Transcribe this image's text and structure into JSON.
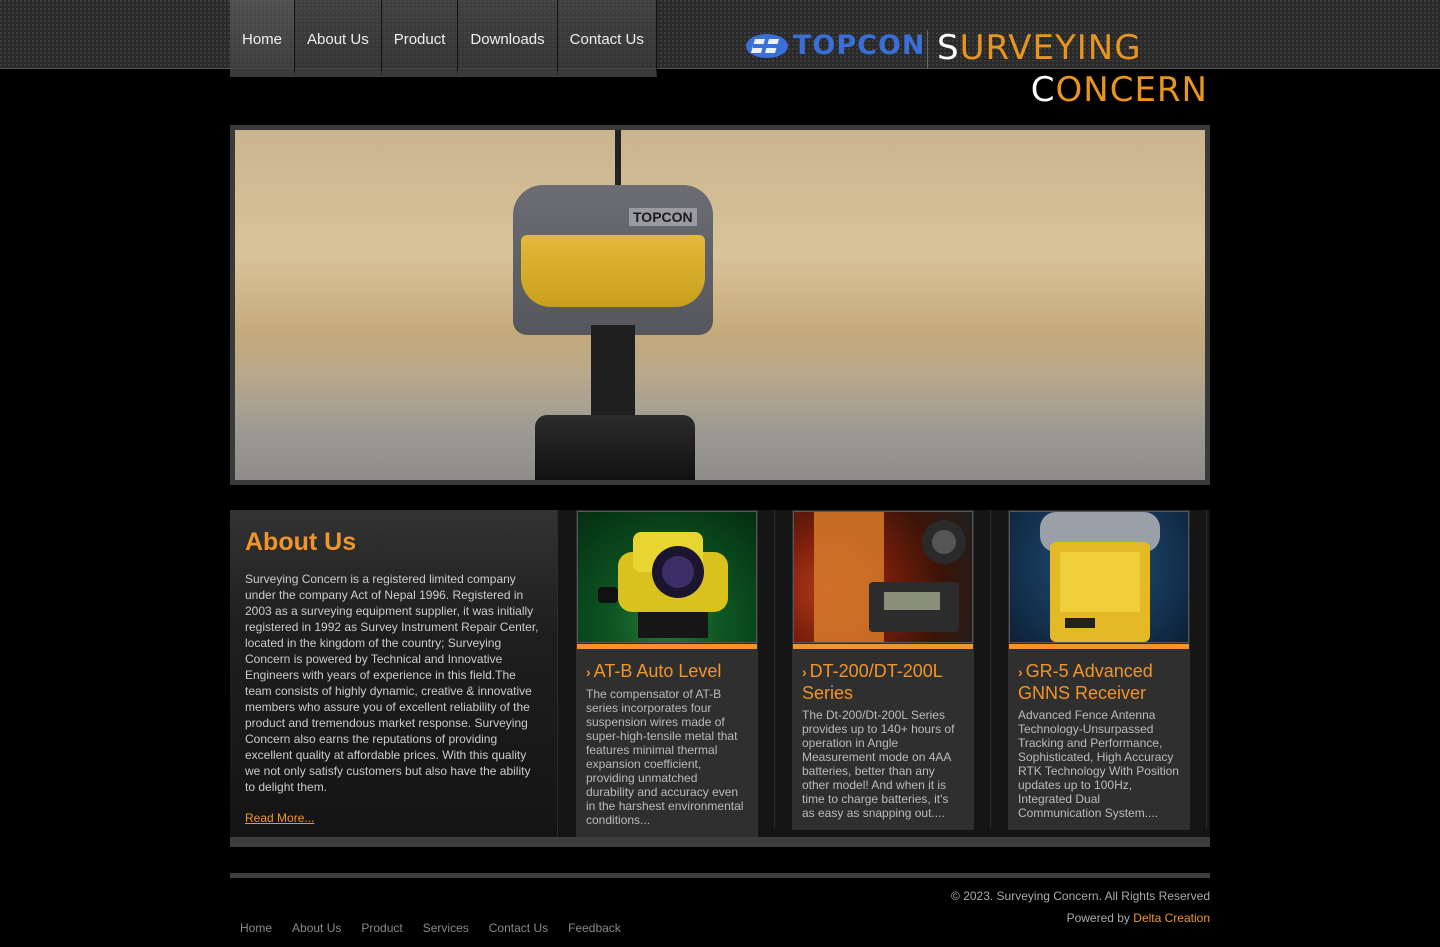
{
  "nav": {
    "items": [
      "Home",
      "About Us",
      "Product",
      "Downloads",
      "Contact Us"
    ]
  },
  "logo": {
    "brand": "TOPCON",
    "word1_cap": "S",
    "word1_rest": "URVEYING",
    "word2_cap": "C",
    "word2_rest": "ONCERN"
  },
  "banner": {
    "device_label": "TOPCON"
  },
  "about": {
    "title": "About Us",
    "body": "Surveying Concern is a registered limited company under the company Act of Nepal 1996. Registered in 2003 as a surveying equipment supplier, it was initially registered in 1992 as Survey Instrument Repair Center, located in the kingdom of the country; Surveying Concern is powered by Technical and Innovative Engineers with years of experience in this field.The team consists of highly dynamic, creative & innovative members who assure you of excellent reliability of the product and tremendous market response. Surveying Concern also earns the reputations of providing excellent quality at affordable prices. With this quality we not only satisfy customers but also have the ability to delight them.",
    "read_more": "Read More..."
  },
  "products": [
    {
      "title": "AT-B Auto Level",
      "desc": "The compensator of AT-B series incorporates four suspension wires made of super-high-tensile metal that features minimal thermal expansion coefficient, providing unmatched durability and accuracy even in the harshest environmental conditions..."
    },
    {
      "title": "DT-200/DT-200L Series",
      "desc": "The Dt-200/Dt-200L Series provides up to 140+ hours of operation in Angle Measurement mode on 4AA batteries, better than any other model! And when it is time to charge batteries, it's as easy as snapping out...."
    },
    {
      "title": "GR-5 Advanced GNNS Receiver",
      "desc": "Advanced Fence Antenna Technology-Unsurpassed Tracking and Performance, Sophisticated, High Accuracy RTK Technology With Position updates up to 100Hz, Integrated Dual Communication System...."
    }
  ],
  "footer": {
    "copyright": "© 2023. Surveying Concern. All Rights Reserved",
    "powered_by": "Powered by",
    "powered_link": "Delta Creation",
    "links": [
      "Home",
      "About Us",
      "Product",
      "Services",
      "Contact Us",
      "Feedback"
    ]
  },
  "colors": {
    "accent": "#f0952a",
    "brand_blue": "#3a6fd8"
  }
}
